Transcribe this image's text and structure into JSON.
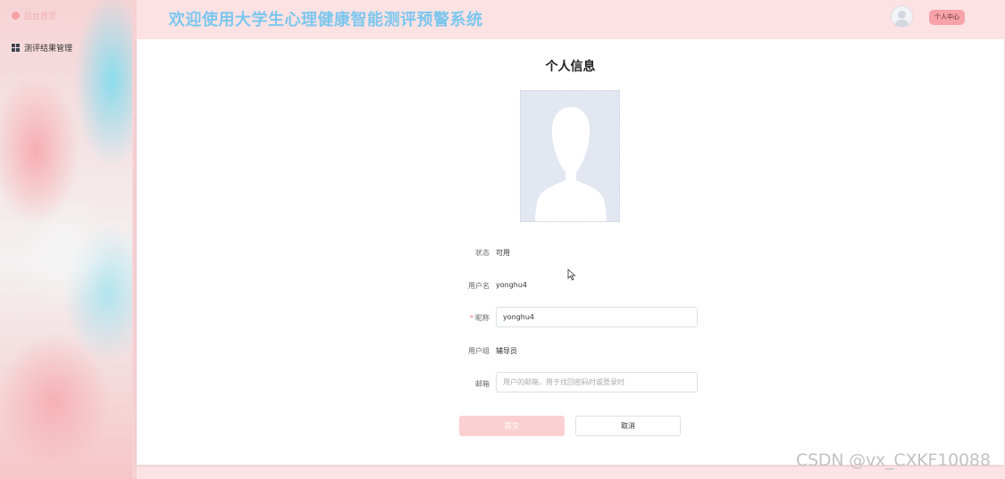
{
  "sidebar": {
    "items": [
      {
        "label": "后台首页",
        "icon": "home-icon"
      },
      {
        "label": "测评结果管理",
        "icon": "grid-icon"
      }
    ]
  },
  "header": {
    "title": "欢迎使用大学生心理健康智能测评预警系统",
    "personal_center": "个人中心",
    "avatar_icon": "user-avatar-icon"
  },
  "main": {
    "title": "个人信息",
    "avatar_icon": "default-avatar-icon",
    "fields": {
      "status": {
        "label": "状态",
        "value": "可用"
      },
      "username": {
        "label": "用户名",
        "value": "yonghu4"
      },
      "nickname": {
        "label": "昵称",
        "required_mark": "*",
        "value": "yonghu4"
      },
      "usergroup": {
        "label": "用户组",
        "value": "辅导员"
      },
      "email": {
        "label": "邮箱",
        "value": "",
        "placeholder": "用户的邮箱，用于找回密码时或登录时"
      }
    },
    "submit_label": "提交",
    "cancel_label": "取消"
  },
  "watermark": "CSDN @vx_CXKF10088",
  "colors": {
    "accent": "#f6a2a8",
    "title_blue": "#7bc7ee",
    "header_bg": "#fde2e4",
    "required": "#f56c6c"
  }
}
